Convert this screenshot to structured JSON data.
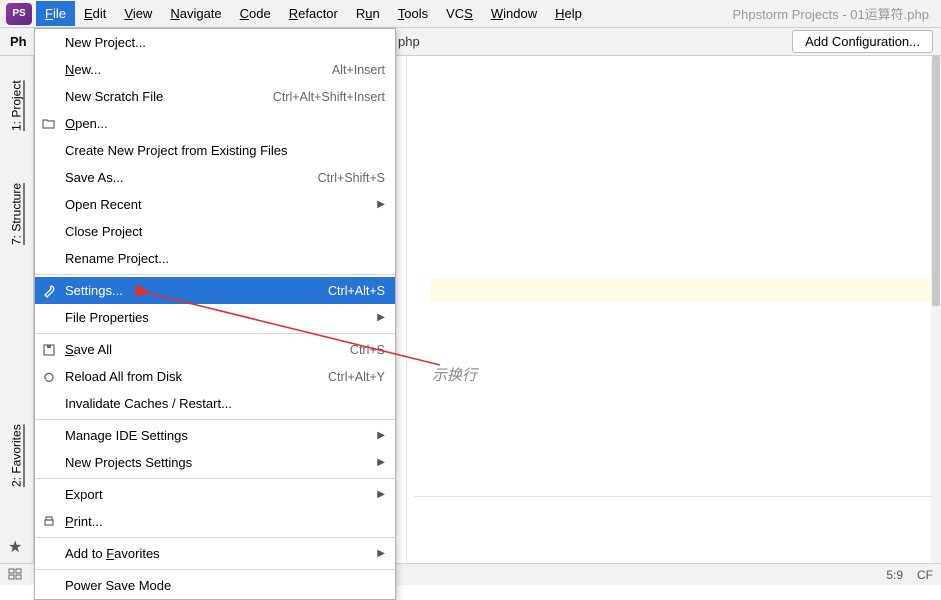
{
  "menubar": {
    "items": [
      {
        "label": "File",
        "underline": "F",
        "rest": "ile",
        "active": true
      },
      {
        "label": "Edit",
        "underline": "E",
        "rest": "dit"
      },
      {
        "label": "View",
        "underline": "V",
        "rest": "iew"
      },
      {
        "label": "Navigate",
        "underline": "N",
        "rest": "avigate"
      },
      {
        "label": "Code",
        "underline": "C",
        "rest": "ode"
      },
      {
        "label": "Refactor",
        "underline": "R",
        "rest": "efactor"
      },
      {
        "label": "Run",
        "underline": "",
        "rest": "R",
        "u2": "u",
        "rest2": "n"
      },
      {
        "label": "Tools",
        "underline": "T",
        "rest": "ools"
      },
      {
        "label": "VCS",
        "underline": "",
        "rest": "VC",
        "u2": "S",
        "rest2": ""
      },
      {
        "label": "Window",
        "underline": "W",
        "rest": "indow"
      },
      {
        "label": "Help",
        "underline": "H",
        "rest": "elp"
      }
    ],
    "window_title": "Phpstorm Projects - 01运算符.php"
  },
  "toolbar": {
    "breadcrumb": "Ph",
    "breadcrumb_tab": "php",
    "add_config": "Add Configuration..."
  },
  "sidebar": {
    "tabs": [
      {
        "label": "1: Project"
      },
      {
        "label": "7: Structure"
      },
      {
        "label": "2: Favorites"
      }
    ]
  },
  "file_menu": {
    "items": [
      {
        "label": "New Project...",
        "type": "item"
      },
      {
        "label": "New...",
        "u": "N",
        "rest": "ew...",
        "shortcut": "Alt+Insert",
        "type": "item"
      },
      {
        "label": "New Scratch File",
        "shortcut": "Ctrl+Alt+Shift+Insert",
        "type": "item"
      },
      {
        "label": "Open...",
        "u": "O",
        "rest": "pen...",
        "icon": "folder",
        "type": "item"
      },
      {
        "label": "Create New Project from Existing Files",
        "type": "item"
      },
      {
        "label": "Save As...",
        "shortcut": "Ctrl+Shift+S",
        "type": "item"
      },
      {
        "label": "Open Recent",
        "submenu": true,
        "type": "item"
      },
      {
        "label": "Close Project",
        "type": "item"
      },
      {
        "label": "Rename Project...",
        "type": "item"
      },
      {
        "type": "sep"
      },
      {
        "label": "Settings...",
        "shortcut": "Ctrl+Alt+S",
        "icon": "wrench",
        "selected": true,
        "type": "item"
      },
      {
        "label": "File Properties",
        "submenu": true,
        "type": "item"
      },
      {
        "type": "sep"
      },
      {
        "label": "Save All",
        "u": "S",
        "rest": "ave All",
        "shortcut": "Ctrl+S",
        "icon": "save",
        "type": "item"
      },
      {
        "label": "Reload All from Disk",
        "shortcut": "Ctrl+Alt+Y",
        "icon": "reload",
        "type": "item"
      },
      {
        "label": "Invalidate Caches / Restart...",
        "type": "item"
      },
      {
        "type": "sep"
      },
      {
        "label": "Manage IDE Settings",
        "submenu": true,
        "type": "item"
      },
      {
        "label": "New Projects Settings",
        "submenu": true,
        "type": "item"
      },
      {
        "type": "sep"
      },
      {
        "label": "Export",
        "submenu": true,
        "type": "item"
      },
      {
        "label": "Print...",
        "u": "P",
        "rest": "rint...",
        "icon": "print",
        "type": "item"
      },
      {
        "type": "sep"
      },
      {
        "label": "Add to Favorites",
        "rest0": "Add to ",
        "u": "F",
        "rest": "avorites",
        "submenu": true,
        "type": "item"
      },
      {
        "type": "sep"
      },
      {
        "label": "Power Save Mode",
        "type": "item"
      }
    ]
  },
  "editor": {
    "hint_text": "示换行"
  },
  "statusbar": {
    "position": "5:9",
    "encoding_prefix": "CF"
  }
}
